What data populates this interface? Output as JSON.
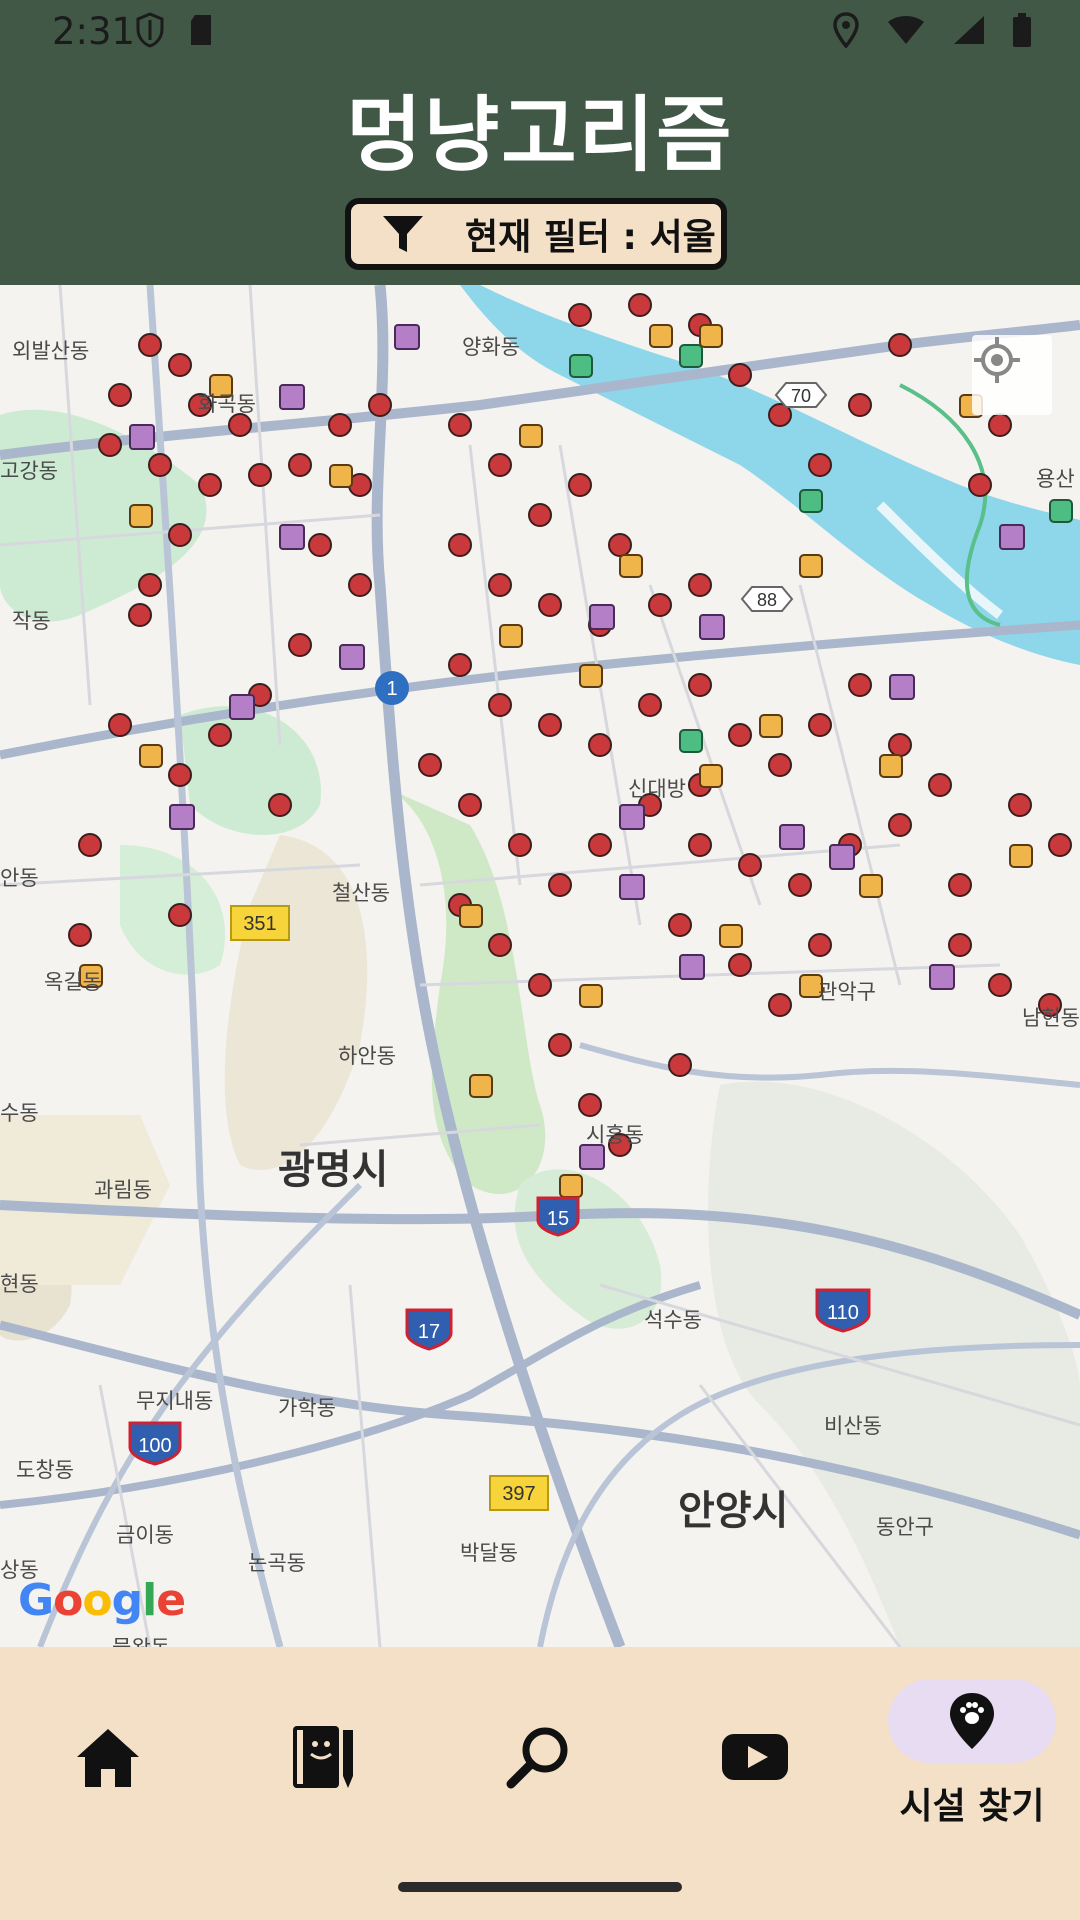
{
  "status_bar": {
    "time": "2:31"
  },
  "app": {
    "title": "멍냥고리즘"
  },
  "filter": {
    "label": "현재 필터 :  서울"
  },
  "map": {
    "labels": [
      {
        "text": "외발산동"
      },
      {
        "text": "화곡동"
      },
      {
        "text": "양화동"
      },
      {
        "text": "고강동"
      },
      {
        "text": "작동"
      },
      {
        "text": "철산동"
      },
      {
        "text": "옥길동"
      },
      {
        "text": "하안동"
      },
      {
        "text": "광명시"
      },
      {
        "text": "과림동"
      },
      {
        "text": "수동"
      },
      {
        "text": "현동"
      },
      {
        "text": "무지내동"
      },
      {
        "text": "가학동"
      },
      {
        "text": "도창동"
      },
      {
        "text": "금이동"
      },
      {
        "text": "논곡동"
      },
      {
        "text": "박달동"
      },
      {
        "text": "안양시"
      },
      {
        "text": "석수동"
      },
      {
        "text": "비산동"
      },
      {
        "text": "동안구"
      },
      {
        "text": "관악구"
      },
      {
        "text": "남현동"
      },
      {
        "text": "용산"
      },
      {
        "text": "시흥동"
      },
      {
        "text": "신대방"
      },
      {
        "text": "상동"
      },
      {
        "text": "안동"
      },
      {
        "text": "물왕동"
      }
    ],
    "route_shields": [
      "70",
      "88",
      "1",
      "351",
      "15",
      "17",
      "110",
      "100",
      "397"
    ],
    "attribution": "Google"
  },
  "bottom_nav": {
    "items": [
      {
        "icon": "home-icon"
      },
      {
        "icon": "diary-icon"
      },
      {
        "icon": "search-icon"
      },
      {
        "icon": "youtube-icon"
      },
      {
        "icon": "paw-location-icon",
        "label": "시설 찾기",
        "active": true
      }
    ]
  },
  "colors": {
    "header_bg": "#425847",
    "nav_bg": "#f3e0c7",
    "filter_bg": "#f3e0c7",
    "active_pill": "#e7dcf2",
    "river": "#8ed6ea"
  }
}
